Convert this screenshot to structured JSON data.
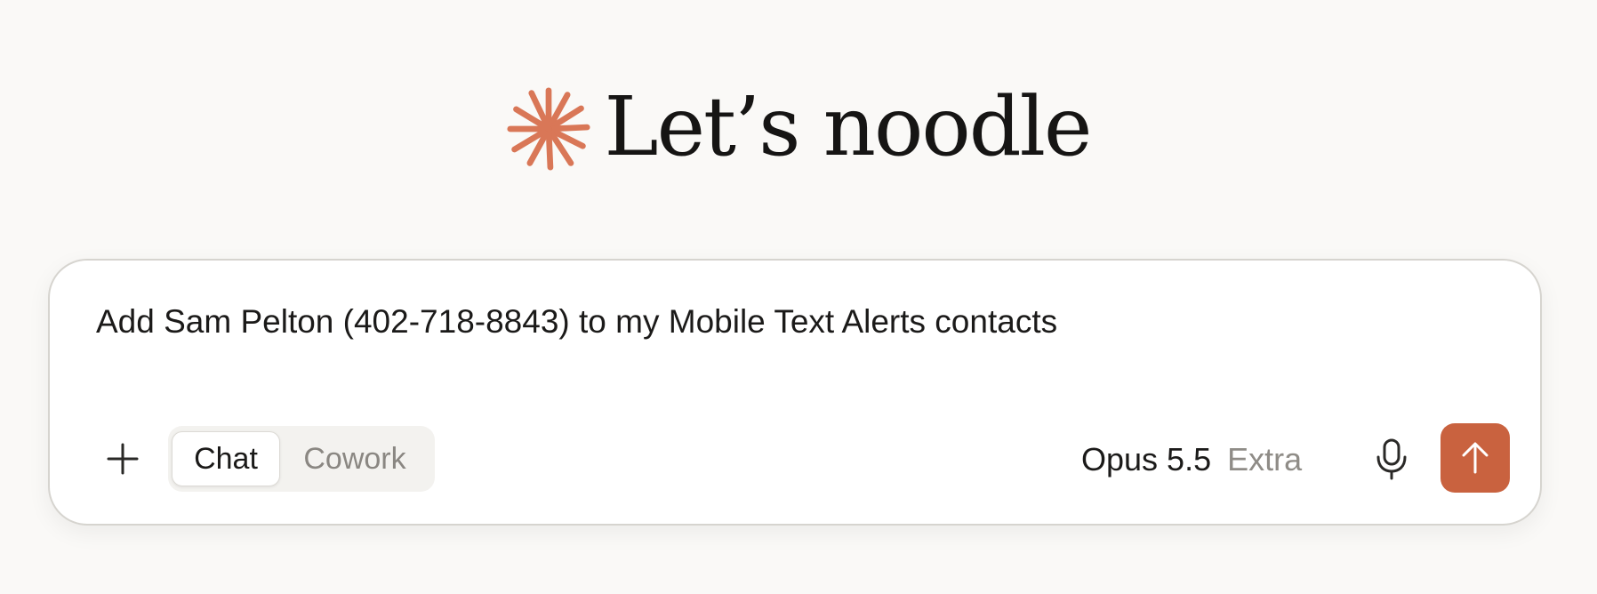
{
  "greeting": {
    "text": "Let’s noodle",
    "logo_icon": "sparkle-asterisk-icon",
    "accent_color": "#d97757"
  },
  "composer": {
    "prompt_value": "Add Sam Pelton (402-718-8843) to my Mobile Text Alerts contacts",
    "add_icon": "plus-icon",
    "modes": [
      {
        "label": "Chat",
        "selected": true
      },
      {
        "label": "Cowork",
        "selected": false
      }
    ],
    "model": {
      "name": "Opus 5.5",
      "effort": "Extra"
    },
    "mic_icon": "microphone-icon",
    "send_icon": "arrow-up-icon",
    "send_color": "#c9623f"
  }
}
